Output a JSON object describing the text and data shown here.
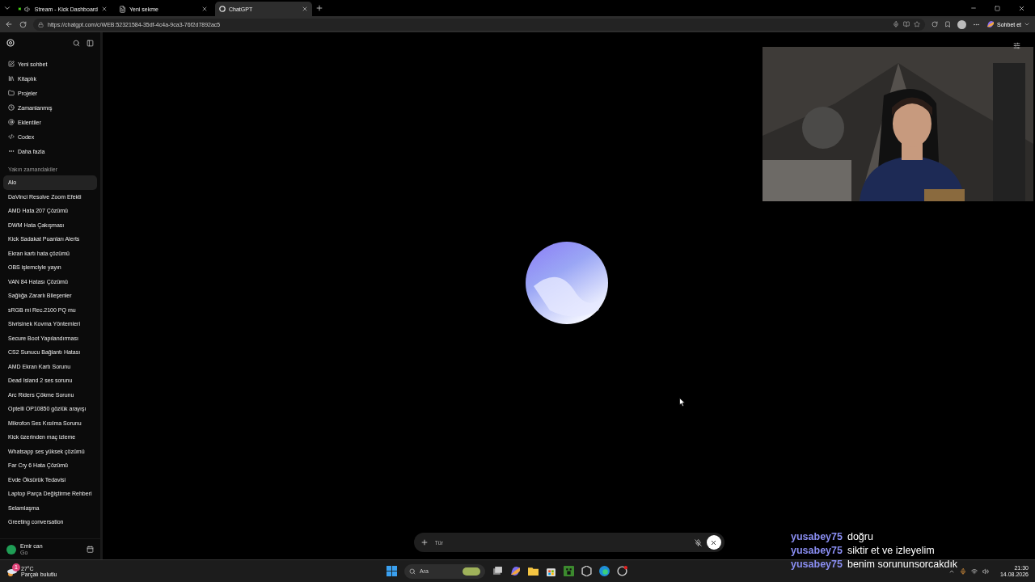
{
  "browser": {
    "tabs": [
      {
        "label": "Stream - Kick Dashboard",
        "selected": false
      },
      {
        "label": "Yeni sekme",
        "selected": false
      },
      {
        "label": "ChatGPT",
        "selected": true
      }
    ],
    "url": "https://chatgpt.com/c/WEB:52321584-35df-4c4a-9ca3-76f2d7892ac5",
    "copilot_label": "Sohbet et"
  },
  "sidebar": {
    "nav": [
      {
        "label": "Yeni sohbet"
      },
      {
        "label": "Kitaplık"
      },
      {
        "label": "Projeler"
      },
      {
        "label": "Zamanlanmış"
      },
      {
        "label": "Eklentiler"
      },
      {
        "label": "Codex"
      },
      {
        "label": "Daha fazla"
      }
    ],
    "section_title": "Yakın zamandakiler",
    "chats": [
      {
        "label": "Alo",
        "selected": true
      },
      {
        "label": "DaVinci Resolve Zoom Efekti",
        "selected": false
      },
      {
        "label": "AMD Hata 207 Çözümü",
        "selected": false
      },
      {
        "label": "DWM Hata Çakışması",
        "selected": false
      },
      {
        "label": "Kick Sadakat Puanları Alerts",
        "selected": false
      },
      {
        "label": "Ekran kartı hata çözümü",
        "selected": false
      },
      {
        "label": "OBS işlemciyle yayın",
        "selected": false
      },
      {
        "label": "VAN 84 Hatası Çözümü",
        "selected": false
      },
      {
        "label": "Sağlığa Zararlı Bileşenler",
        "selected": false
      },
      {
        "label": "sRGB mi Rec.2100 PQ mu",
        "selected": false
      },
      {
        "label": "Sivrisinek Kovma Yöntemleri",
        "selected": false
      },
      {
        "label": "Secure Boot Yapılandırması",
        "selected": false
      },
      {
        "label": "CS2 Sunucu Bağlantı Hatası",
        "selected": false
      },
      {
        "label": "AMD Ekran Kartı Sorunu",
        "selected": false
      },
      {
        "label": "Dead Island 2 ses sorunu",
        "selected": false
      },
      {
        "label": "Arc Riders Çökme Sorunu",
        "selected": false
      },
      {
        "label": "Optelli OP10850 gözlük arayışı",
        "selected": false
      },
      {
        "label": "Mikrofon Ses Kısılma Sorunu",
        "selected": false
      },
      {
        "label": "Kick üzerinden maç izleme",
        "selected": false
      },
      {
        "label": "Whatsapp ses yüksek çözümü",
        "selected": false
      },
      {
        "label": "Far Cry 6 Hata Çözümü",
        "selected": false
      },
      {
        "label": "Evde Öksürük Tedavisi",
        "selected": false
      },
      {
        "label": "Laptop Parça Değiştirme Rehberi",
        "selected": false
      },
      {
        "label": "Selamlaşma",
        "selected": false
      },
      {
        "label": "Greeting conversation",
        "selected": false
      }
    ],
    "user": {
      "name": "Emir can",
      "plan": "Go"
    }
  },
  "composer": {
    "placeholder": "Tür"
  },
  "chat_overlay": [
    {
      "user": "yusabey75",
      "text": "doğru"
    },
    {
      "user": "yusabey75",
      "text": "siktir et ve izleyelim"
    },
    {
      "user": "yusabey75",
      "text": "benim sorununsorcakdık"
    }
  ],
  "taskbar": {
    "weather_temp": "27°C",
    "weather_text": "Parçalı bulutlu",
    "weather_badge": "1",
    "search_placeholder": "Ara",
    "time": "21:30",
    "date": "14.08.2026"
  }
}
